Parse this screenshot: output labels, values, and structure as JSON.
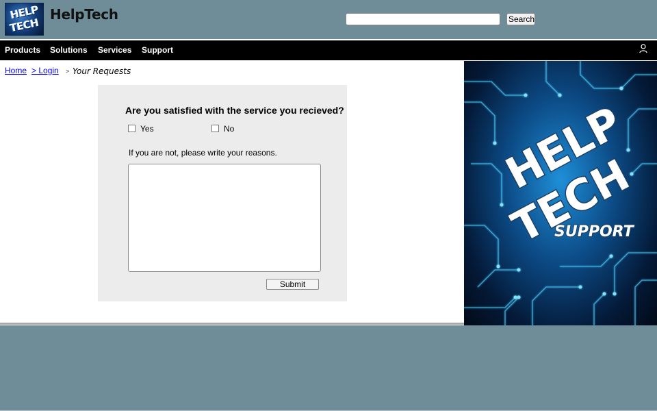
{
  "header": {
    "logo_text_line1": "HELP",
    "logo_text_line2": "TECH",
    "brand_title": "HelpTech",
    "search": {
      "placeholder": "",
      "value": "",
      "button_label": "Search"
    }
  },
  "nav": {
    "items": [
      {
        "label": "Products"
      },
      {
        "label": "Solutions"
      },
      {
        "label": "Services"
      },
      {
        "label": "Support"
      }
    ],
    "user_icon": "user-icon"
  },
  "breadcrumb": {
    "home": "Home",
    "login": "> Login",
    "separator": ">",
    "current": "Your Requests"
  },
  "survey": {
    "question": "Are you satisfied with the service you recieved?",
    "options": [
      {
        "label": "Yes",
        "checked": false
      },
      {
        "label": "No",
        "checked": false
      }
    ],
    "reason_label": "If you are not, please write your reasons.",
    "reason_value": "",
    "submit_label": "Submit"
  },
  "banner": {
    "line1": "HELP",
    "line2": "TECH",
    "line3": "SUPPORT"
  },
  "colors": {
    "header_bg": "#6e8d99",
    "nav_bg": "#000000",
    "panel_bg": "#ececec",
    "link": "#0000ee",
    "banner_glow": "#1f8fd8"
  }
}
